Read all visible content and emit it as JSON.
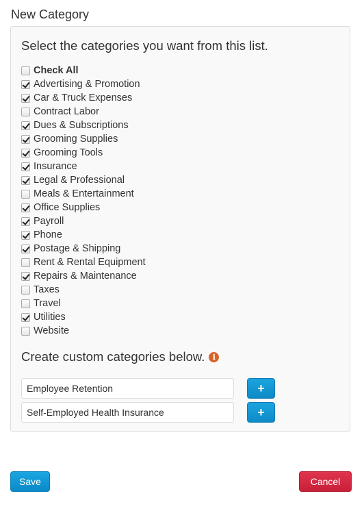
{
  "page": {
    "title": "New Category"
  },
  "panel": {
    "heading": "Select the categories you want from this list.",
    "check_all": {
      "label": "Check All",
      "checked": false
    },
    "categories": [
      {
        "label": "Advertising & Promotion",
        "checked": true
      },
      {
        "label": "Car & Truck Expenses",
        "checked": true
      },
      {
        "label": "Contract Labor",
        "checked": false
      },
      {
        "label": "Dues & Subscriptions",
        "checked": true
      },
      {
        "label": "Grooming Supplies",
        "checked": true
      },
      {
        "label": "Grooming Tools",
        "checked": true
      },
      {
        "label": "Insurance",
        "checked": true
      },
      {
        "label": "Legal & Professional",
        "checked": true
      },
      {
        "label": "Meals & Entertainment",
        "checked": false
      },
      {
        "label": "Office Supplies",
        "checked": true
      },
      {
        "label": "Payroll",
        "checked": true
      },
      {
        "label": "Phone",
        "checked": true
      },
      {
        "label": "Postage & Shipping",
        "checked": true
      },
      {
        "label": "Rent & Rental Equipment",
        "checked": false
      },
      {
        "label": "Repairs & Maintenance",
        "checked": true
      },
      {
        "label": "Taxes",
        "checked": false
      },
      {
        "label": "Travel",
        "checked": false
      },
      {
        "label": "Utilities",
        "checked": true
      },
      {
        "label": "Website",
        "checked": false
      }
    ],
    "custom": {
      "heading": "Create custom categories below.",
      "info_icon": "info-circle-icon",
      "info_color": "#d5652b",
      "inputs": [
        {
          "value": "Employee Retention",
          "add_label": "+"
        },
        {
          "value": "Self-Employed Health Insurance",
          "add_label": "+"
        }
      ]
    }
  },
  "actions": {
    "save_label": "Save",
    "cancel_label": "Cancel",
    "save_color": "#1199d6",
    "cancel_color": "#d42a44"
  }
}
